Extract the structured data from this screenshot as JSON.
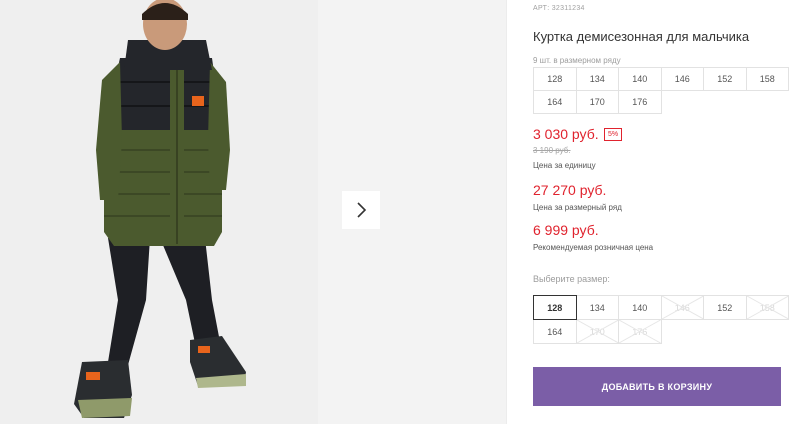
{
  "gallery": {
    "photo_alt": "boy in green and black winter jacket",
    "next_icon": "chevron-right-icon"
  },
  "product": {
    "article": "АРТ: 32311234",
    "title": "Куртка демисезонная для мальчика",
    "row_note": "9 шт. в размерном ряду",
    "row_sizes": [
      "128",
      "134",
      "140",
      "146",
      "152",
      "158",
      "164",
      "170",
      "176"
    ]
  },
  "pricing": {
    "unit_price": "3 030 руб.",
    "discount": "5%",
    "old_price": "3 190 руб.",
    "unit_note": "Цена за единицу",
    "row_price": "27 270 руб.",
    "row_note": "Цена за размерный ряд",
    "retail_price": "6 999 руб.",
    "retail_note": "Рекомендуемая розничная цена"
  },
  "size_picker": {
    "label": "Выберите размер:",
    "sizes": [
      {
        "label": "128",
        "state": "selected"
      },
      {
        "label": "134",
        "state": "available"
      },
      {
        "label": "140",
        "state": "available"
      },
      {
        "label": "146",
        "state": "unavailable"
      },
      {
        "label": "152",
        "state": "available"
      },
      {
        "label": "158",
        "state": "unavailable"
      },
      {
        "label": "164",
        "state": "available"
      },
      {
        "label": "170",
        "state": "unavailable"
      },
      {
        "label": "176",
        "state": "unavailable"
      }
    ]
  },
  "cart": {
    "button_label": "ДОБАВИТЬ В КОРЗИНУ"
  },
  "colors": {
    "accent": "#7b5ea7",
    "price": "#e0232e"
  }
}
